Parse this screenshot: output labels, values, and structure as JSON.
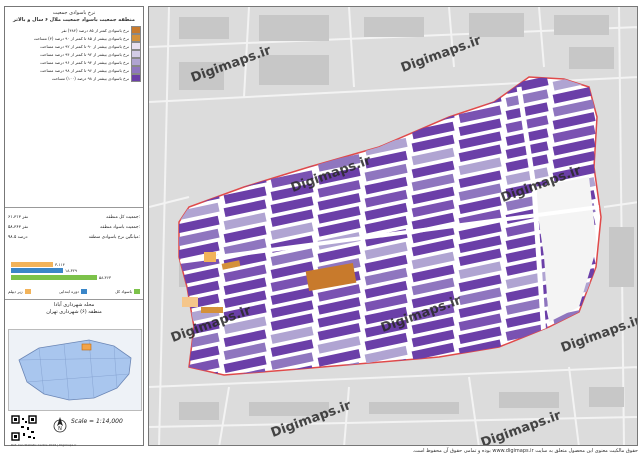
{
  "legend": {
    "title_1": "نرخ باسوادی جمعیت",
    "title_2": "منطقه جمعیت باسواد جمعیت ملال ۶ سال و بالاتر",
    "classes": [
      {
        "label": "نرخ باسوادی کمتر از ۸۵ درصد (۴۸۴) نفر",
        "color": "#c87a2c"
      },
      {
        "label": "نرخ باسوادی بیشتر از ۸۵ تا کمتر از ۹۰ درصد (۴) مساحت",
        "color": "#d4913a"
      },
      {
        "label": "نرخ باسوادی بیشتر از ۹۰ تا کمتر از ۹۲ درصد مساحت",
        "color": "#e8e0f0"
      },
      {
        "label": "نرخ باسوادی بیشتر از ۹۲ تا کمتر از ۹۴ درصد مساحت",
        "color": "#d3cce6"
      },
      {
        "label": "نرخ باسوادی بیشتر از ۹۴ تا کمتر از ۹۶ درصد مساحت",
        "color": "#b0a4d2"
      },
      {
        "label": "نرخ باسوادی بیشتر از ۹۶ تا کمتر از ۹۸ درصد مساحت",
        "color": "#8f76bf"
      },
      {
        "label": "نرخ باسوادی بیشتر از ۹۸ درصد (۱۰۰) مساحت",
        "color": "#6b3fa8"
      }
    ],
    "stats": [
      {
        "label": "جمعیت کل منطقه:",
        "value": "۶۱،۳۱۳ نفر"
      },
      {
        "label": "جمعیت باسواد منطقه:",
        "value": "۵۸،۳۶۳ نفر"
      },
      {
        "label": "میانگین نرخ باسوادی منطقه:",
        "value": "۹۸.۵ درصد"
      }
    ],
    "bars": [
      {
        "value": "۳،۱۱۴",
        "fraction": 0.42,
        "color": "#f2b35a"
      },
      {
        "value": "۱۸،۳۲۹",
        "fraction": 0.52,
        "color": "#3a86c8"
      },
      {
        "value": "۵۸،۳۶۳",
        "fraction": 0.86,
        "color": "#7cc24a"
      }
    ],
    "bar_legend": [
      {
        "label": "باسواد کل",
        "color": "#7cc24a"
      },
      {
        "label": "دوره ابتدایی",
        "color": "#3a86c8"
      },
      {
        "label": "زیر دیپلم",
        "color": "#f2b35a"
      }
    ],
    "area_title_1": "محله شهرداری آبادا",
    "area_title_2": "منطقه (۶) شهرداری تهران",
    "scale": "Scale = 1:14,000",
    "north_letter": "N",
    "credits": "Ref: Iran Statistic Centre 2016 | Digimaps.ir"
  },
  "watermark": "Digimaps.ir",
  "footer": "حقوق مالکیت معنوی این محصول متعلق به سایت www.digimaps.ir بوده و تمامی حقوق آن محفوظ است.",
  "colors": {
    "boundary": "#e04a4a",
    "background_map": "#dcdcdc",
    "darkest_class": "#6b3fa8"
  }
}
